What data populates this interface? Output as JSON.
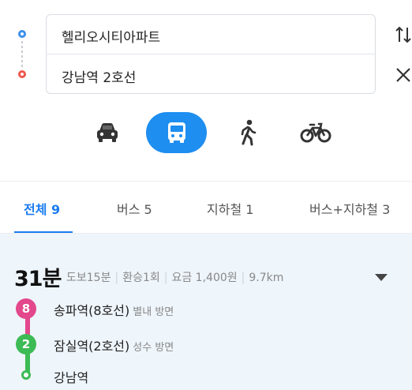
{
  "route": {
    "origin": "헬리오시티아파트",
    "destination": "강남역 2호선"
  },
  "modes": [
    {
      "name": "car",
      "icon": "car-icon",
      "active": false
    },
    {
      "name": "bus",
      "icon": "bus-icon",
      "active": true
    },
    {
      "name": "walk",
      "icon": "walk-icon",
      "active": false
    },
    {
      "name": "bike",
      "icon": "bike-icon",
      "active": false
    }
  ],
  "tabs": [
    {
      "label": "전체",
      "count": "9",
      "active": true
    },
    {
      "label": "버스",
      "count": "5",
      "active": false
    },
    {
      "label": "지하철",
      "count": "1",
      "active": false
    },
    {
      "label": "버스+지하철",
      "count": "3",
      "active": false
    }
  ],
  "result": {
    "duration": "31분",
    "walk": "도보15분",
    "transfers": "환승1회",
    "fare": "요금 1,400원",
    "distance": "9.7km",
    "steps": [
      {
        "line": "8",
        "station": "송파역(8호선)",
        "direction": "별내 방면",
        "color": "#e3478c"
      },
      {
        "line": "2",
        "station": "잠실역(2호선)",
        "direction": "성수 방면",
        "color": "#3dbb55"
      },
      {
        "line": "",
        "station": "강남역",
        "direction": ""
      }
    ]
  },
  "colors": {
    "accent": "#1e8ef0",
    "origin": "#3b8fea",
    "destination": "#f0574d"
  }
}
